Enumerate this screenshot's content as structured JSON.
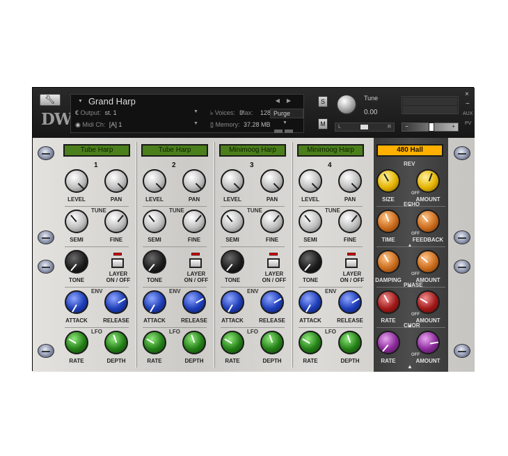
{
  "header": {
    "instrument_name": "Grand Harp",
    "output_label": "Output:",
    "output_value": "st. 1",
    "voices_label": "Voices:",
    "voices_value": "0",
    "max_label": "Max:",
    "max_value": "128",
    "purge_label": "Purge",
    "midi_label": "Midi Ch:",
    "midi_value": "[A]  1",
    "memory_label": "Memory:",
    "memory_value": "37.28 MB",
    "logo": "DW",
    "solo_label": "S",
    "mute_label": "M",
    "tune_label": "Tune",
    "tune_value": "0.00",
    "pan_left": "L",
    "pan_right": "R",
    "vol_minus": "−",
    "vol_plus": "+",
    "aux_label": "AUX",
    "pv_label": "PV",
    "close_glyph": "×",
    "minimize_glyph": "−"
  },
  "layers": [
    {
      "preset": "Tube Harp",
      "number": "1"
    },
    {
      "preset": "Tube Harp",
      "number": "2"
    },
    {
      "preset": "Minimoog Harp",
      "number": "3"
    },
    {
      "preset": "Minimoog Harp",
      "number": "4"
    }
  ],
  "layer_labels": {
    "level": "LEVEL",
    "pan": "PAN",
    "tune": "TUNE",
    "semi": "SEMI",
    "fine": "FINE",
    "tone": "TONE",
    "layer": "LAYER",
    "onoff": "ON / OFF",
    "env": "ENV",
    "attack": "ATTACK",
    "release": "RELEASE",
    "lfo": "LFO",
    "rate": "RATE",
    "depth": "DEPTH"
  },
  "fx": {
    "reverb_preset": "480 Hall",
    "rev": "REV",
    "echo": "ECHO",
    "phase": "PHASE",
    "chor": "CHOR",
    "size": "SIZE",
    "amount": "AMOUNT",
    "off": "OFF",
    "time": "TIME",
    "feedback": "FEEDBACK",
    "damping": "DAMPING",
    "rate": "RATE"
  },
  "colors": {
    "lcd_green": "#4b7f1b",
    "lcd_amber": "#ffb000",
    "knob_env": "#1e3eb8",
    "knob_lfo": "#237e16",
    "knob_rev": "#e4b200",
    "knob_echo": "#c96b1c",
    "knob_phase": "#a11818",
    "knob_chor": "#8a2a9a"
  },
  "icons": {
    "wrench": "wrench-icon",
    "output": "output-icon",
    "midi": "midi-icon",
    "voices": "voices-icon",
    "memory": "memory-icon"
  }
}
